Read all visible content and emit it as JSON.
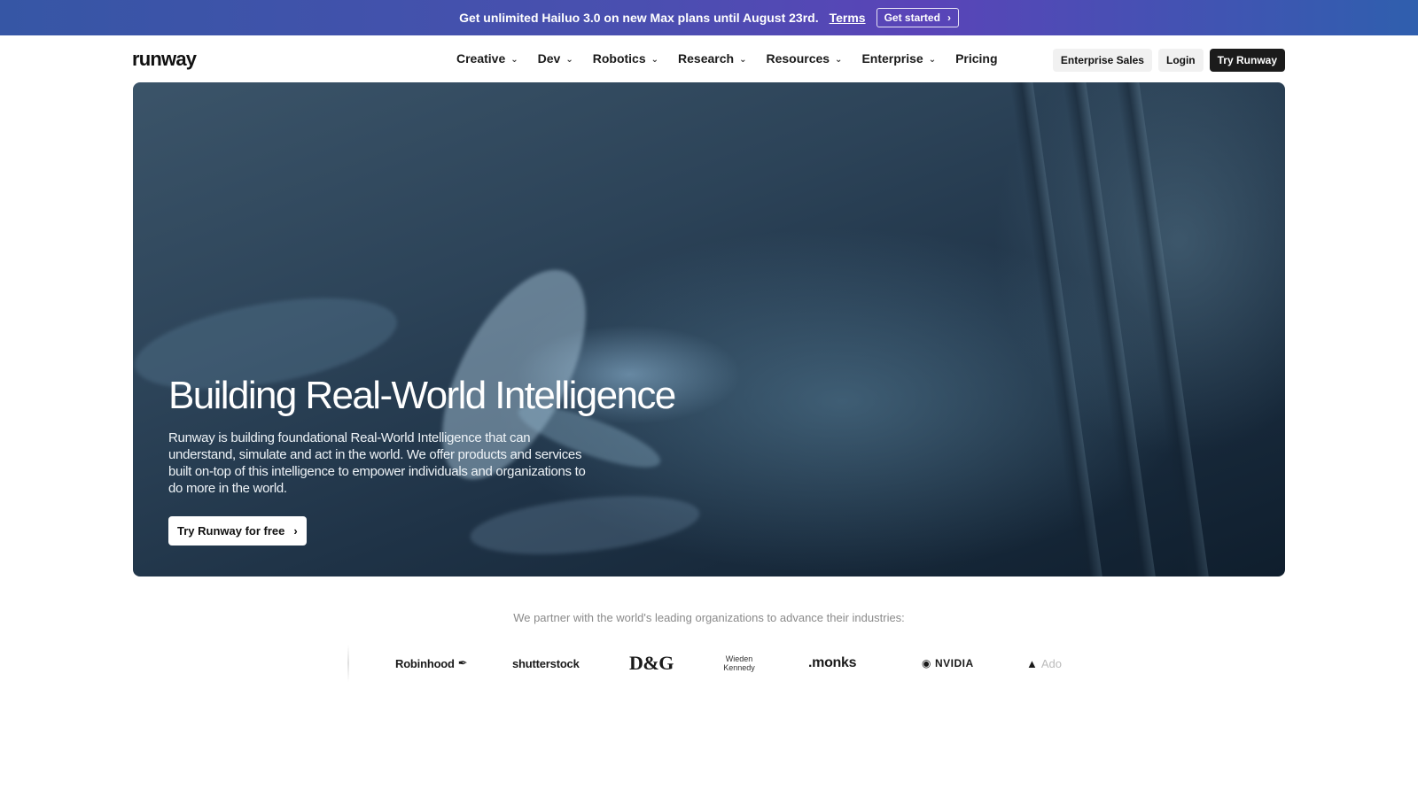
{
  "banner": {
    "message": "Get unlimited Hailuo 3.0 on new Max plans until August 23rd.",
    "terms_label": "Terms",
    "cta_label": "Get started"
  },
  "nav": {
    "logo_text": "runway",
    "items": [
      {
        "label": "Creative"
      },
      {
        "label": "Dev"
      },
      {
        "label": "Robotics"
      },
      {
        "label": "Research"
      },
      {
        "label": "Resources"
      },
      {
        "label": "Enterprise"
      },
      {
        "label": "Pricing"
      }
    ],
    "enterprise_sales_label": "Enterprise Sales",
    "login_label": "Login",
    "try_label": "Try Runway"
  },
  "hero": {
    "title": "Building Real-World Intelligence",
    "description": "Runway is building foundational Real-World Intelligence that can understand, simulate and act in the world. We offer products and services built on-top of this intelligence to empower individuals and organizations to do more in the world.",
    "cta_label": "Try Runway for free"
  },
  "partners": {
    "text": "We partner with the world's leading organizations to advance their industries:",
    "logos": {
      "robinhood": "Robinhood",
      "shutterstock": "shutterstock",
      "dg": "D&G",
      "wieden_line1": "Wieden",
      "wieden_line2": "Kennedy",
      "monks": ".monks",
      "nvidia": "NVIDIA",
      "adobe_visible": "Ado"
    }
  },
  "colors": {
    "banner_gradient_start": "#3656a5",
    "banner_gradient_mid": "#5a44b8",
    "dark_button": "#1b1b1b",
    "light_button": "#f1f1f1"
  }
}
